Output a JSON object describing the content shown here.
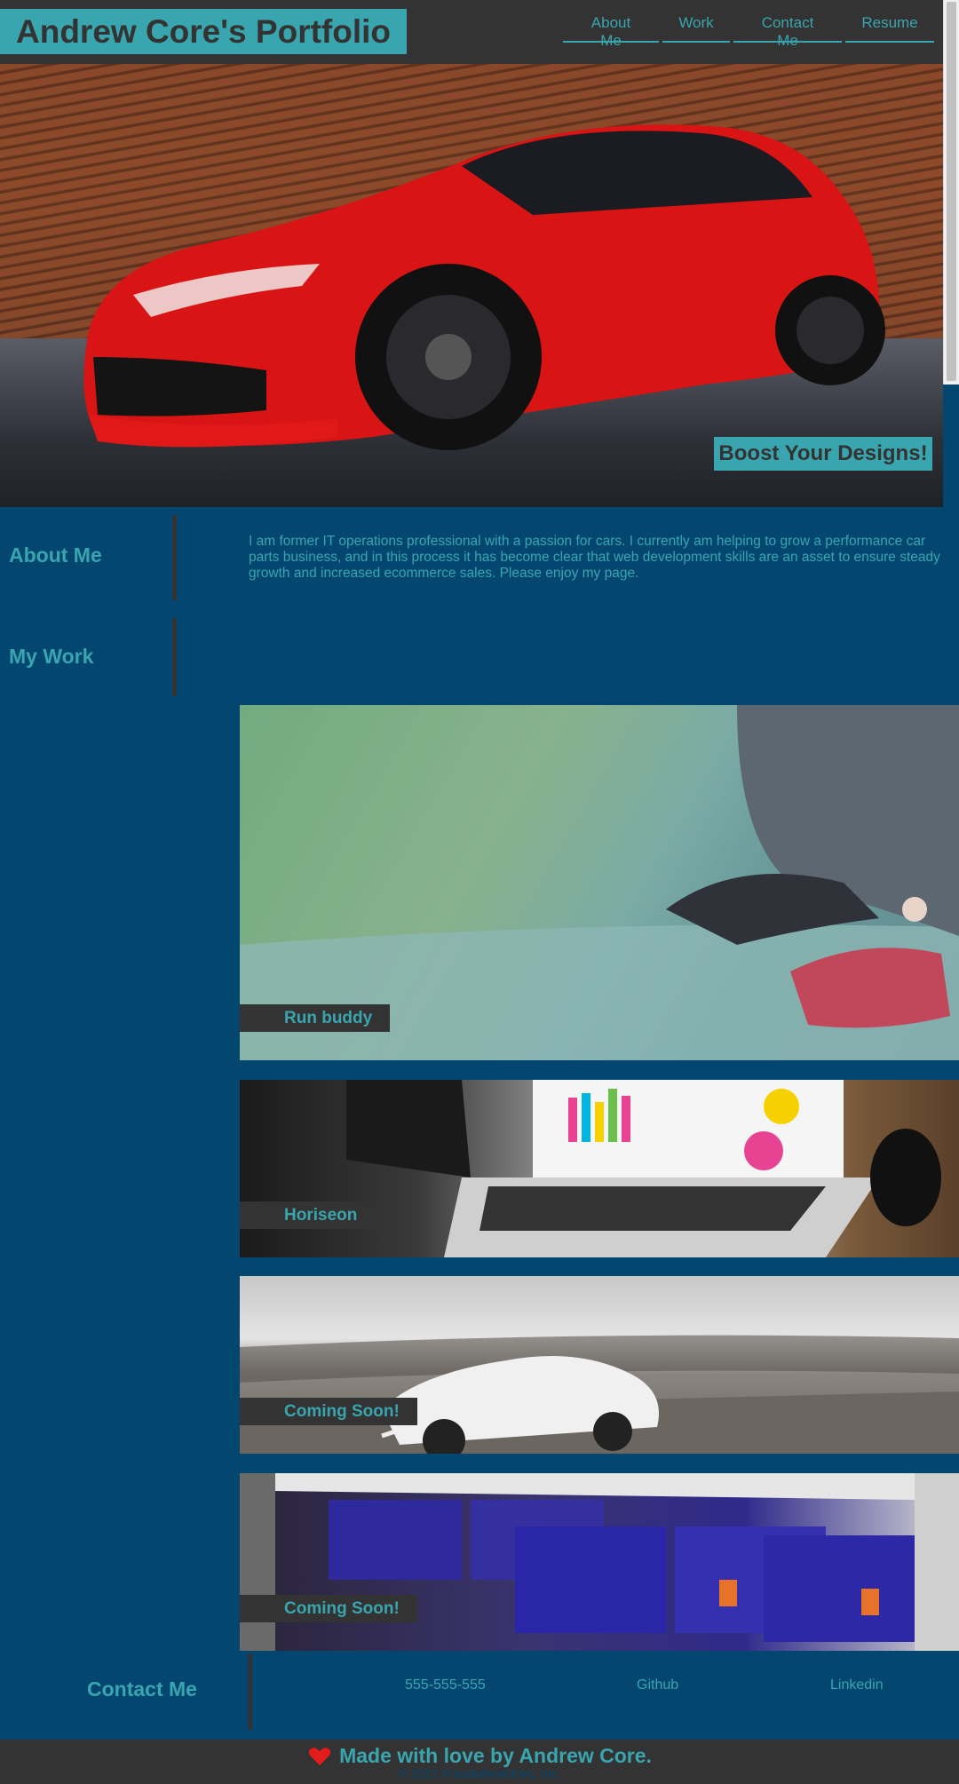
{
  "header": {
    "title": "Andrew Core's Portfolio",
    "nav": [
      {
        "label": "About Me"
      },
      {
        "label": "Work"
      },
      {
        "label": "Contact Me"
      },
      {
        "label": "Resume"
      }
    ]
  },
  "hero": {
    "tagline": "Boost Your Designs!"
  },
  "about": {
    "heading": "About Me",
    "text": "I am former IT operations professional with a passion for cars. I currently am helping to grow a performance car parts business, and in this process it has become clear that web development skills are an asset to ensure steady growth and increased ecommerce sales. Please enjoy my page."
  },
  "work": {
    "heading": "My Work",
    "items": [
      {
        "label": "Run buddy",
        "icon": "running-shoes-image"
      },
      {
        "label": "Horiseon",
        "icon": "laptop-analytics-image"
      },
      {
        "label": "Coming Soon!",
        "icon": "sports-car-image"
      },
      {
        "label": "Coming Soon!",
        "icon": "brake-boxes-image"
      }
    ]
  },
  "contact": {
    "heading": "Contact Me",
    "phone": "555-555-555",
    "github": "Github",
    "linkedin": "Linkedin"
  },
  "footer": {
    "made_with": "Made with love by Andrew Core.",
    "copyright": "© 2021 Fraudwheeldrive, Inc.",
    "icon": "heart-icon"
  },
  "colors": {
    "background": "#034771",
    "accent": "#39a5ae",
    "dark": "#333333"
  }
}
